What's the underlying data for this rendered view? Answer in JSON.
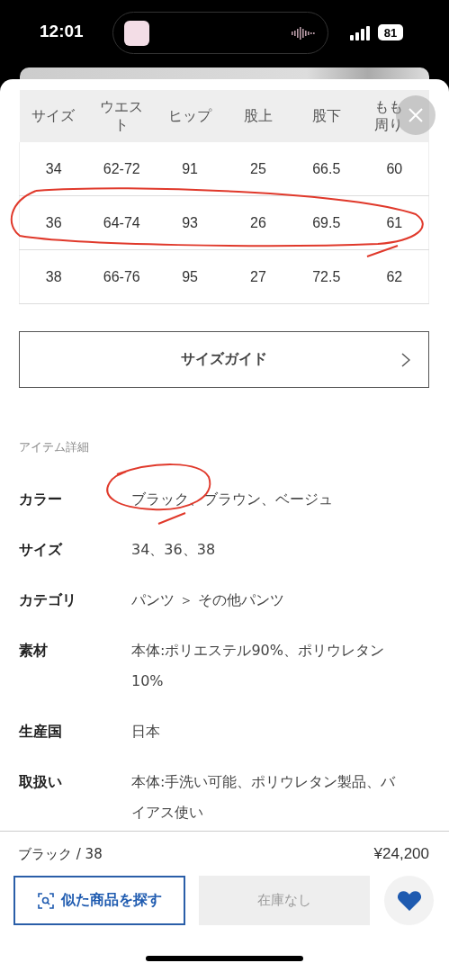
{
  "status_bar": {
    "time": "12:01",
    "battery": "81"
  },
  "size_table": {
    "columns": [
      "サイズ",
      "ウエスト",
      "ヒップ",
      "股上",
      "股下",
      "もも周り"
    ],
    "rows": [
      [
        "34",
        "62-72",
        "91",
        "25",
        "66.5",
        "60"
      ],
      [
        "36",
        "64-74",
        "93",
        "26",
        "69.5",
        "61"
      ],
      [
        "38",
        "66-76",
        "95",
        "27",
        "72.5",
        "62"
      ]
    ]
  },
  "size_guide_button": {
    "label": "サイズガイド"
  },
  "item_details": {
    "heading": "アイテム詳細",
    "rows": [
      {
        "label": "カラー",
        "value": "ブラック、ブラウン、ベージュ"
      },
      {
        "label": "サイズ",
        "value": "34、36、38"
      },
      {
        "label": "カテゴリ",
        "value": "パンツ ＞ その他パンツ"
      },
      {
        "label": "素材",
        "value": "本体:ポリエステル90%、ポリウレタン10%"
      },
      {
        "label": "生産国",
        "value": "日本"
      },
      {
        "label": "取扱い",
        "value": "本体:手洗い可能、ポリウレタン製品、バイアス使い"
      }
    ]
  },
  "footer": {
    "variant": "ブラック / 38",
    "price": "¥24,200",
    "similar_button": "似た商品を探す",
    "stock_button": {
      "label": "在庫なし",
      "disabled": true
    },
    "favorite": {
      "selected": true
    }
  }
}
